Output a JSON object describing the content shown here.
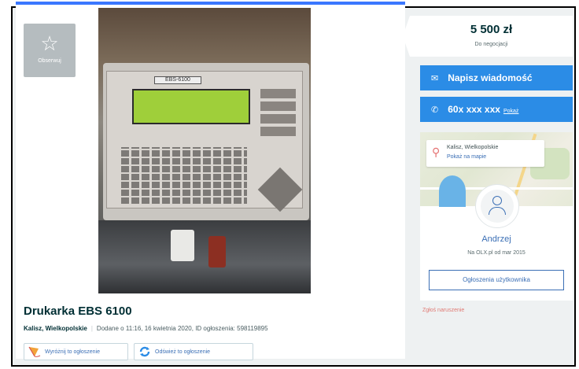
{
  "listing": {
    "observe_label": "Obserwuj",
    "title": "Drukarka EBS 6100",
    "location": "Kalisz, Wielkopolskie",
    "added_info": "Dodane o 11:16, 16 kwietnia 2020, ID ogłoszenia: 598119895",
    "photo_brand_text": "EBS-6100",
    "promo_highlight_label": "Wyróżnij to ogłoszenie",
    "promo_refresh_label": "Odśwież to ogłoszenie"
  },
  "price": {
    "amount": "5 500 zł",
    "negotiable": "Do negocjacji"
  },
  "contact": {
    "message_label": "Napisz wiadomość",
    "phone_masked": "60x xxx xxx",
    "phone_show": "Pokaż"
  },
  "seller": {
    "map_city": "Kalisz, Wielkopolskie",
    "map_link": "Pokaż na mapie",
    "name": "Andrzej",
    "member_since": "Na OLX.pl od mar 2015",
    "user_ads_label": "Ogłoszenia użytkownika"
  },
  "report_label": "Zgłoś naruszenie",
  "colors": {
    "accent": "#2b8ce6",
    "link": "#3b6fb5",
    "report": "#e07a74"
  },
  "icons": {
    "observe": "star-icon",
    "message": "envelope-icon",
    "phone": "phone-icon",
    "location": "map-pin-icon",
    "avatar": "user-icon"
  }
}
